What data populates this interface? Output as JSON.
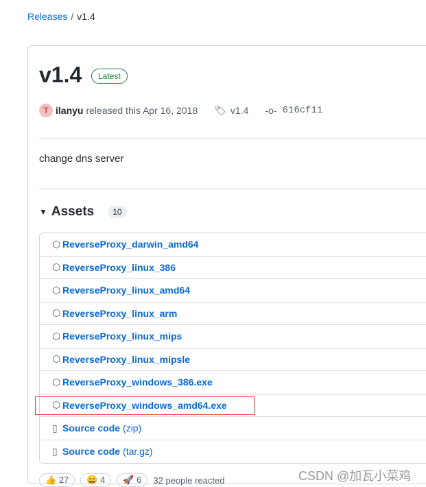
{
  "breadcrumb": {
    "parent": "Releases",
    "current": "v1.4"
  },
  "release": {
    "title": "v1.4",
    "badge": "Latest",
    "author": "ilanyu",
    "released": "released this Apr 16, 2018",
    "tag": "v1.4",
    "commit": "616cf11",
    "description": "change dns server"
  },
  "assets": {
    "label": "Assets",
    "count": "10",
    "items": [
      {
        "name": "ReverseProxy_darwin_amd64",
        "icon": "package-icon"
      },
      {
        "name": "ReverseProxy_linux_386",
        "icon": "package-icon"
      },
      {
        "name": "ReverseProxy_linux_amd64",
        "icon": "package-icon"
      },
      {
        "name": "ReverseProxy_linux_arm",
        "icon": "package-icon"
      },
      {
        "name": "ReverseProxy_linux_mips",
        "icon": "package-icon"
      },
      {
        "name": "ReverseProxy_linux_mipsle",
        "icon": "package-icon"
      },
      {
        "name": "ReverseProxy_windows_386.exe",
        "icon": "package-icon"
      },
      {
        "name": "ReverseProxy_windows_amd64.exe",
        "icon": "package-icon",
        "highlighted": true
      },
      {
        "name": "Source code",
        "ext": "(zip)",
        "icon": "file-zip-icon"
      },
      {
        "name": "Source code",
        "ext": "(tar.gz)",
        "icon": "file-zip-icon"
      }
    ]
  },
  "reactions": {
    "thumbs": "27",
    "laugh": "4",
    "rocket": "6",
    "summary": "32 people reacted"
  },
  "watermark": "CSDN @加瓦小菜鸡"
}
